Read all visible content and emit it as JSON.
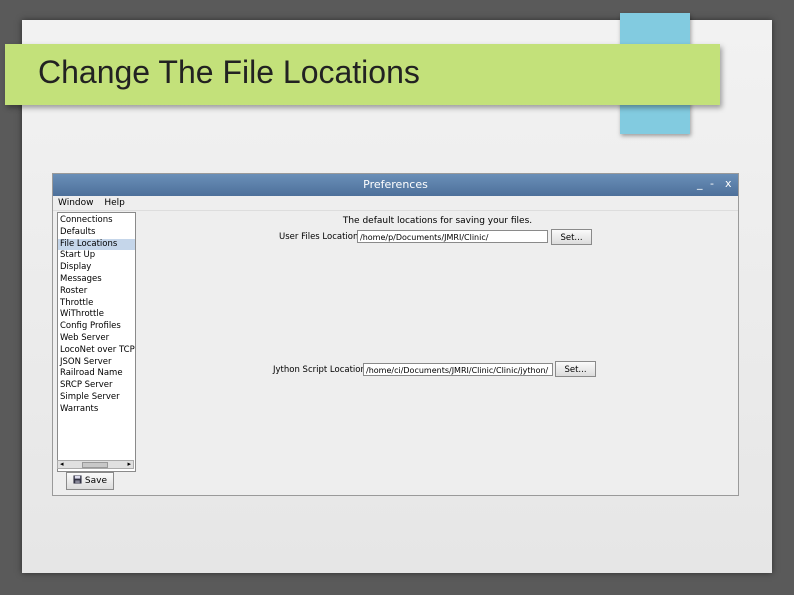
{
  "slide": {
    "title": "Change The File Locations"
  },
  "window": {
    "title": "Preferences",
    "controls": {
      "minimize": "_",
      "maximize": "-",
      "close": "x"
    },
    "menu": [
      "Window",
      "Help"
    ],
    "sidebar": {
      "items": [
        "Connections",
        "Defaults",
        "File Locations",
        "Start Up",
        "Display",
        "Messages",
        "Roster",
        "Throttle",
        "WiThrottle",
        "Config Profiles",
        "Web Server",
        "LocoNet over TCP S",
        "JSON Server",
        "Railroad Name",
        "SRCP Server",
        "Simple Server",
        "Warrants"
      ],
      "selected": "File Locations",
      "scroll_left": "◂",
      "scroll_right": "▸"
    },
    "save_button": {
      "label": "Save"
    },
    "panel": {
      "heading": "The default locations for saving your files.",
      "user_files": {
        "label": "User Files Location",
        "value": "/home/p/Documents/JMRI/Clinic/",
        "button": "Set..."
      },
      "jython": {
        "label": "Jython Script Location",
        "value": "/home/ci/Documents/JMRI/Clinic/Clinic/jython/",
        "button": "Set..."
      }
    }
  },
  "colors": {
    "title_band": "#c3e17a",
    "accent": "#82cbe0",
    "titlebar": "#5a7fa8",
    "selection": "#c5d6ea"
  }
}
